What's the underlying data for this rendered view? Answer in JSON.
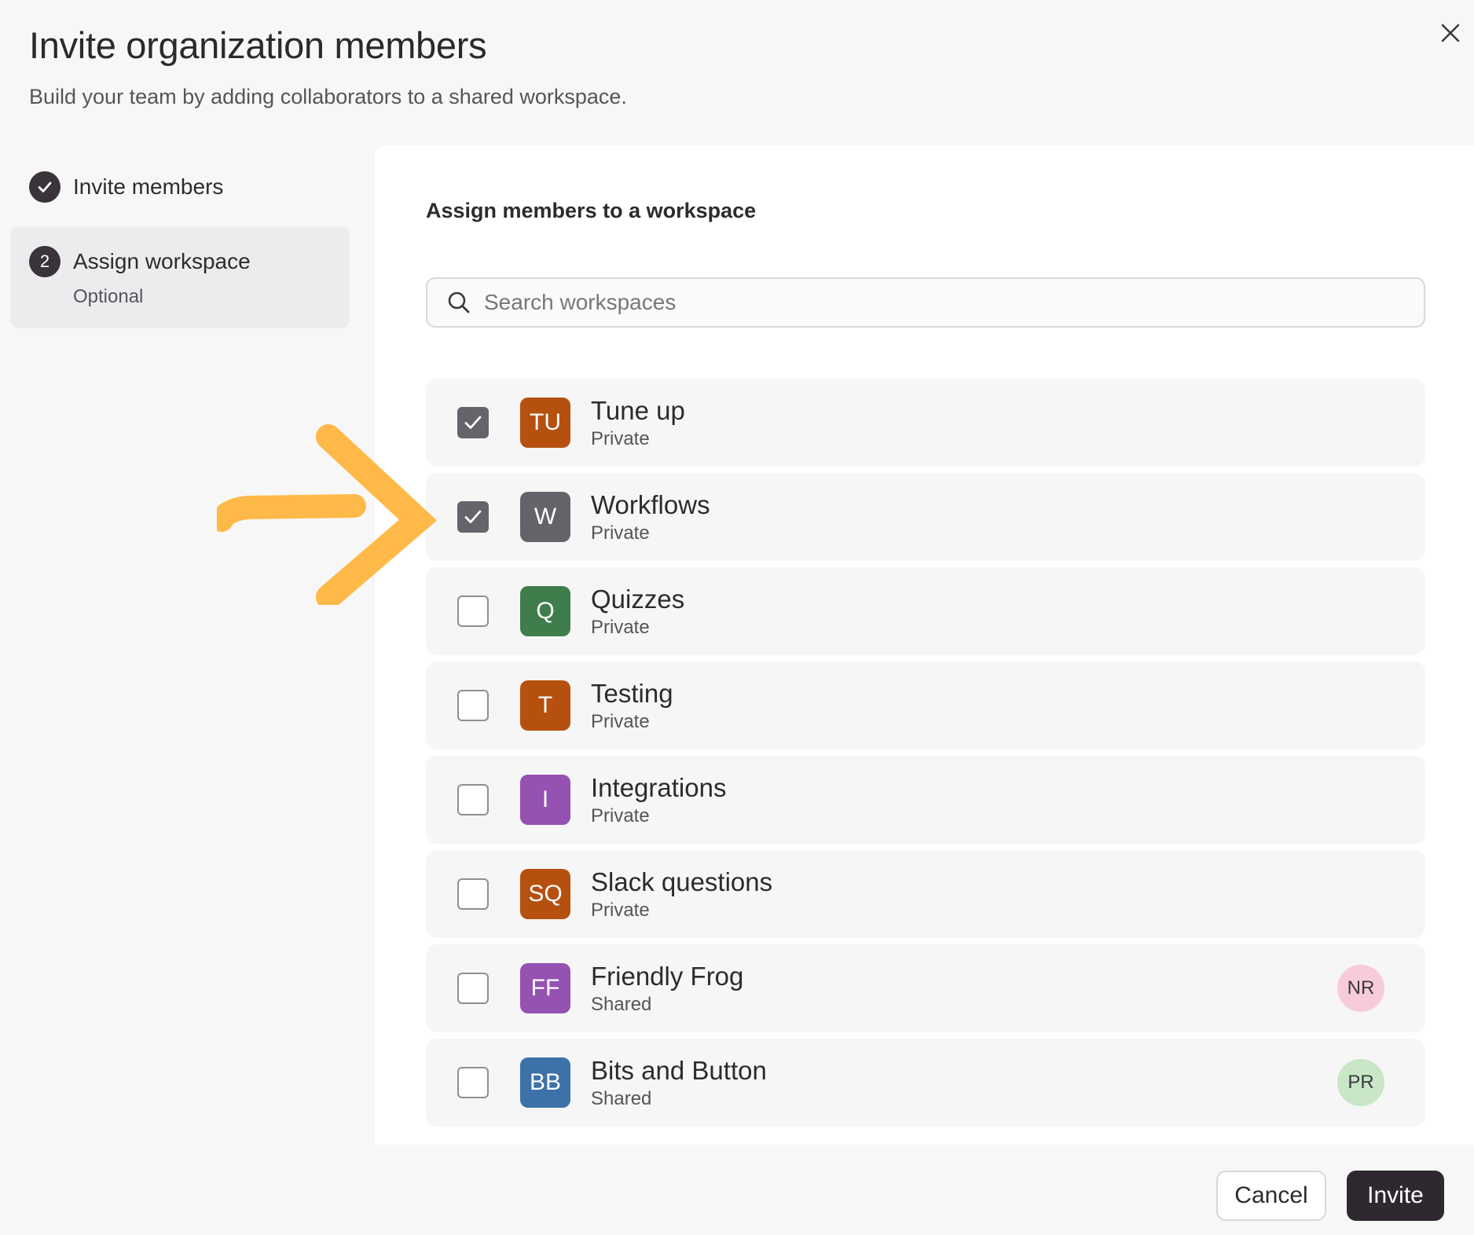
{
  "header": {
    "title": "Invite organization members",
    "subtitle": "Build your team by adding collaborators to a shared workspace."
  },
  "steps": [
    {
      "indicator": "check",
      "label": "Invite members",
      "sub": ""
    },
    {
      "indicator": "2",
      "label": "Assign workspace",
      "sub": "Optional"
    }
  ],
  "panel": {
    "heading": "Assign members to a workspace",
    "search_placeholder": "Search workspaces"
  },
  "workspaces": [
    {
      "initials": "TU",
      "name": "Tune up",
      "type": "Private",
      "checked": true,
      "color": "#b6500f",
      "member": null
    },
    {
      "initials": "W",
      "name": "Workflows",
      "type": "Private",
      "checked": true,
      "color": "#66626a",
      "member": null
    },
    {
      "initials": "Q",
      "name": "Quizzes",
      "type": "Private",
      "checked": false,
      "color": "#3f7d4c",
      "member": null
    },
    {
      "initials": "T",
      "name": "Testing",
      "type": "Private",
      "checked": false,
      "color": "#b6500f",
      "member": null
    },
    {
      "initials": "I",
      "name": "Integrations",
      "type": "Private",
      "checked": false,
      "color": "#9552b3",
      "member": null
    },
    {
      "initials": "SQ",
      "name": "Slack questions",
      "type": "Private",
      "checked": false,
      "color": "#b6500f",
      "member": null
    },
    {
      "initials": "FF",
      "name": "Friendly Frog",
      "type": "Shared",
      "checked": false,
      "color": "#9552b3",
      "member": {
        "initials": "NR",
        "color": "#f7ccd8"
      }
    },
    {
      "initials": "BB",
      "name": "Bits and Button",
      "type": "Shared",
      "checked": false,
      "color": "#3c72a8",
      "member": {
        "initials": "PR",
        "color": "#c9e6c6"
      }
    }
  ],
  "footer": {
    "cancel_label": "Cancel",
    "invite_label": "Invite"
  },
  "colors": {
    "accent_dark": "#2f2830",
    "annotation_arrow": "#ffb948"
  }
}
